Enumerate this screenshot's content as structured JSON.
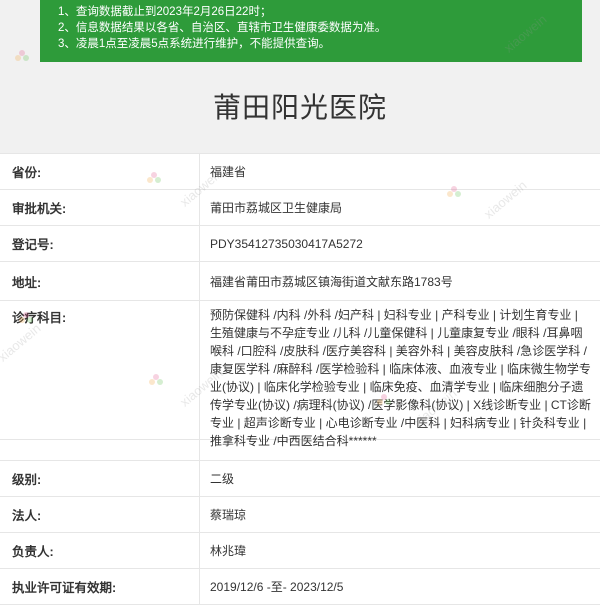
{
  "notice": {
    "line1": "1、查询数据截止到2023年2月26日22时；",
    "line2": "2、信息数据结果以各省、自治区、直辖市卫生健康委数据为准。",
    "line3": "3、凌晨1点至凌晨5点系统进行维护，不能提供查询。"
  },
  "page_title": "莆田阳光医院",
  "fields": {
    "province": {
      "label": "省份:",
      "value": "福建省"
    },
    "authority": {
      "label": "审批机关:",
      "value": "莆田市荔城区卫生健康局"
    },
    "reg_no": {
      "label": "登记号:",
      "value": "PDY35412735030417A5272"
    },
    "address": {
      "label": "地址:",
      "value": "福建省莆田市荔城区镇海街道文献东路1783号"
    },
    "projects": {
      "label": "诊疗科目:",
      "value": "预防保健科 /内科 /外科 /妇产科 | 妇科专业 | 产科专业 | 计划生育专业 | 生殖健康与不孕症专业 /儿科 /儿童保健科 | 儿童康复专业 /眼科 /耳鼻咽喉科 /口腔科 /皮肤科 /医疗美容科 | 美容外科 | 美容皮肤科 /急诊医学科 /康复医学科 /麻醉科 /医学检验科 | 临床体液、血液专业 | 临床微生物学专业(协议) | 临床化学检验专业 | 临床免疫、血清学专业 | 临床细胞分子遗传学专业(协议) /病理科(协议) /医学影像科(协议) | X线诊断专业 | CT诊断专业 | 超声诊断专业 | 心电诊断专业 /中医科 | 妇科病专业 | 针灸科专业 | 推拿科专业 /中西医结合科******"
    },
    "level": {
      "label": "级别:",
      "value": "二级"
    },
    "legal_person": {
      "label": "法人:",
      "value": "蔡瑞琼"
    },
    "principal": {
      "label": "负责人:",
      "value": "林兆瑋"
    },
    "license_period": {
      "label": "执业许可证有效期:",
      "value": "2019/12/6 -至- 2023/12/5"
    }
  },
  "watermark": {
    "text": "xiaowein"
  },
  "colors": {
    "notice_bg": "#2e9b3a",
    "page_bg": "#f1f1f1",
    "border": "#e6e6e6"
  }
}
